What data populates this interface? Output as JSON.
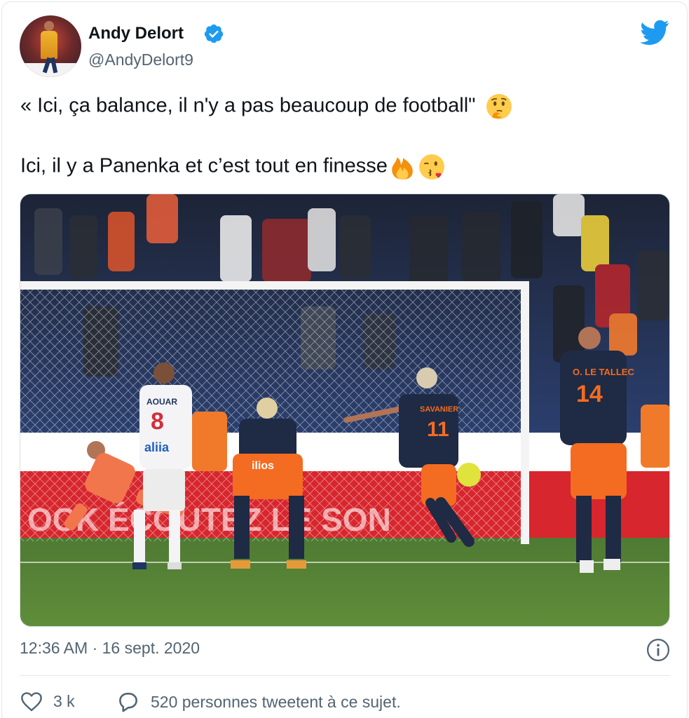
{
  "author": {
    "name": "Andy Delort",
    "handle": "@AndyDelort9",
    "verified": true
  },
  "tweet": {
    "line1": "« Ici, ça balance, il n'y a pas beaucoup de football\"",
    "line1_emoji": "thinking-face",
    "line2": "Ici, il y a Panenka et c’est tout en finesse",
    "line2_emojis": [
      "fire",
      "face-blowing-a-kiss"
    ]
  },
  "photo": {
    "players": [
      {
        "name": "AOUAR",
        "number": "8"
      },
      {
        "name": "SAVANIER",
        "number": "11"
      },
      {
        "name": "O. LE TALLEC",
        "number": "14"
      }
    ],
    "sponsor": "ilios",
    "board": "OCK  ÉCOUTEZ  LE  SON",
    "shirt_sponsor": "aliia"
  },
  "meta": {
    "time": "12:36 AM",
    "separator": "·",
    "date": "16 sept. 2020"
  },
  "actions": {
    "likes": "3 k",
    "conversation": "520 personnes tweetent à ce sujet."
  },
  "colors": {
    "twitter_blue": "#1d9bf0",
    "like_red": "#e0245e",
    "mhsc_orange": "#f36c21",
    "mhsc_navy": "#1f2a44"
  }
}
